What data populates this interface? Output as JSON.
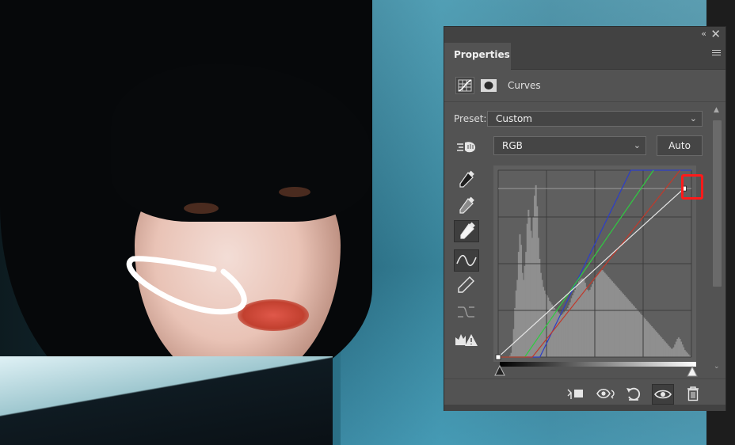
{
  "panel": {
    "tab_label": "Properties",
    "adjustment_name": "Curves",
    "preset_label": "Preset:",
    "preset_value": "Custom",
    "channel_value": "RGB",
    "auto_label": "Auto"
  },
  "icons": {
    "collapse": "«",
    "close": "✕",
    "dropdown": "⌄",
    "scroll_up": "▲",
    "scroll_down": "⌄"
  },
  "colors": {
    "panel_bg": "#535353",
    "highlight": "#ff1a1a",
    "curve_rgb": "#e6e6e6",
    "curve_red": "#c0392b",
    "curve_green": "#2ecc40",
    "curve_blue": "#2c3ec8"
  },
  "chart_data": {
    "type": "line",
    "xlim": [
      0,
      255
    ],
    "ylim": [
      0,
      255
    ],
    "grid": true,
    "series": [
      {
        "name": "RGB",
        "x": [
          0,
          245
        ],
        "y": [
          0,
          230
        ]
      },
      {
        "name": "Red",
        "x": [
          0,
          45,
          240
        ],
        "y": [
          0,
          0,
          255
        ]
      },
      {
        "name": "Green",
        "x": [
          0,
          35,
          205
        ],
        "y": [
          0,
          0,
          255
        ]
      },
      {
        "name": "Blue",
        "x": [
          0,
          55,
          175,
          255
        ],
        "y": [
          0,
          0,
          255,
          255
        ]
      }
    ],
    "histogram": [
      0,
      0,
      0,
      0,
      0,
      0,
      0,
      0,
      0,
      2,
      6,
      18,
      40,
      70,
      95,
      110,
      150,
      175,
      160,
      120,
      110,
      130,
      150,
      190,
      210,
      200,
      180,
      170,
      200,
      230,
      245,
      215,
      170,
      140,
      120,
      110,
      100,
      95,
      90,
      88,
      85,
      80,
      78,
      75,
      72,
      70,
      68,
      66,
      64,
      62,
      60,
      60,
      62,
      64,
      66,
      68,
      70,
      74,
      78,
      84,
      88,
      92,
      96,
      100,
      104,
      108,
      110,
      112,
      112,
      110,
      106,
      100,
      96,
      94,
      96,
      100,
      104,
      108,
      112,
      116,
      118,
      120,
      122,
      124,
      124,
      122,
      120,
      118,
      116,
      114,
      112,
      110,
      108,
      106,
      104,
      102,
      100,
      98,
      96,
      94,
      92,
      90,
      88,
      86,
      84,
      82,
      80,
      78,
      76,
      74,
      72,
      70,
      68,
      66,
      64,
      62,
      60,
      58,
      56,
      54,
      52,
      50,
      48,
      46,
      44,
      42,
      40,
      38,
      36,
      34,
      32,
      30,
      28,
      26,
      24,
      22,
      20,
      18,
      16,
      14,
      12,
      12,
      14,
      18,
      22,
      26,
      28,
      26,
      22,
      18,
      14,
      10,
      8,
      6,
      4,
      2,
      0
    ]
  }
}
